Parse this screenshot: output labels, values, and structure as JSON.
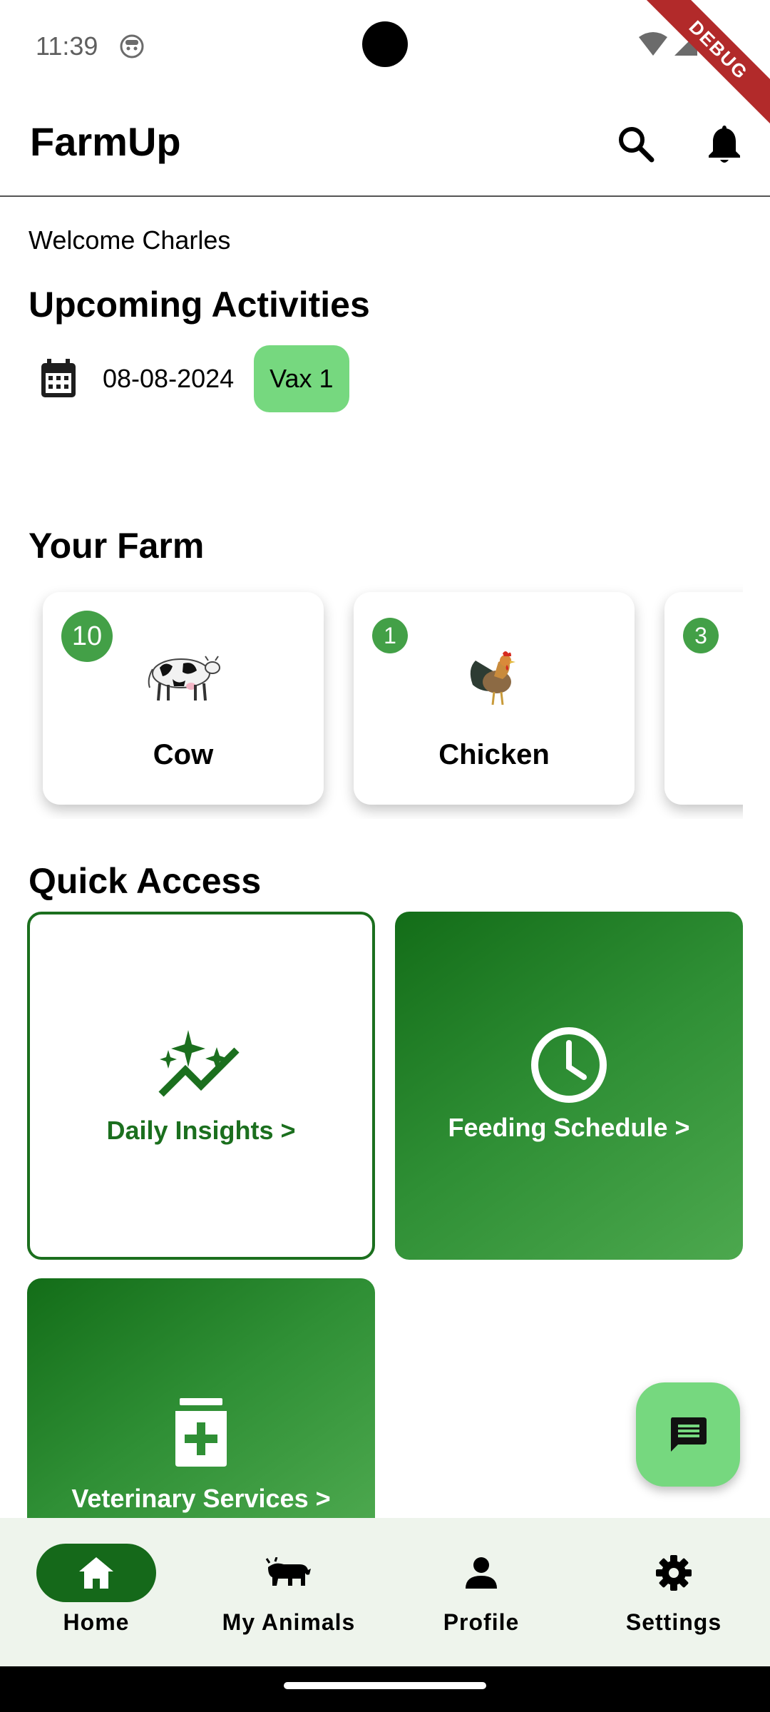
{
  "status_bar": {
    "time": "11:39",
    "debug_label": "DEBUG"
  },
  "app_bar": {
    "title": "FarmUp"
  },
  "welcome": "Welcome Charles",
  "upcoming": {
    "title": "Upcoming Activities",
    "date": "08-08-2024",
    "tag": "Vax 1"
  },
  "farm": {
    "title": "Your Farm",
    "cards": [
      {
        "count": "10",
        "label": "Cow"
      },
      {
        "count": "1",
        "label": "Chicken"
      },
      {
        "count": "3",
        "label": ""
      }
    ]
  },
  "quick_access": {
    "title": "Quick Access",
    "tiles": [
      {
        "label": "Daily Insights >"
      },
      {
        "label": "Feeding Schedule >"
      },
      {
        "label": "Veterinary Services >"
      }
    ]
  },
  "nav": {
    "items": [
      {
        "label": "Home"
      },
      {
        "label": "My Animals"
      },
      {
        "label": "Profile"
      },
      {
        "label": "Settings"
      }
    ]
  },
  "colors": {
    "primary_green": "#15691a",
    "light_green": "#76d87f",
    "badge_green": "#43a047",
    "nav_bg": "#eef4ec"
  }
}
